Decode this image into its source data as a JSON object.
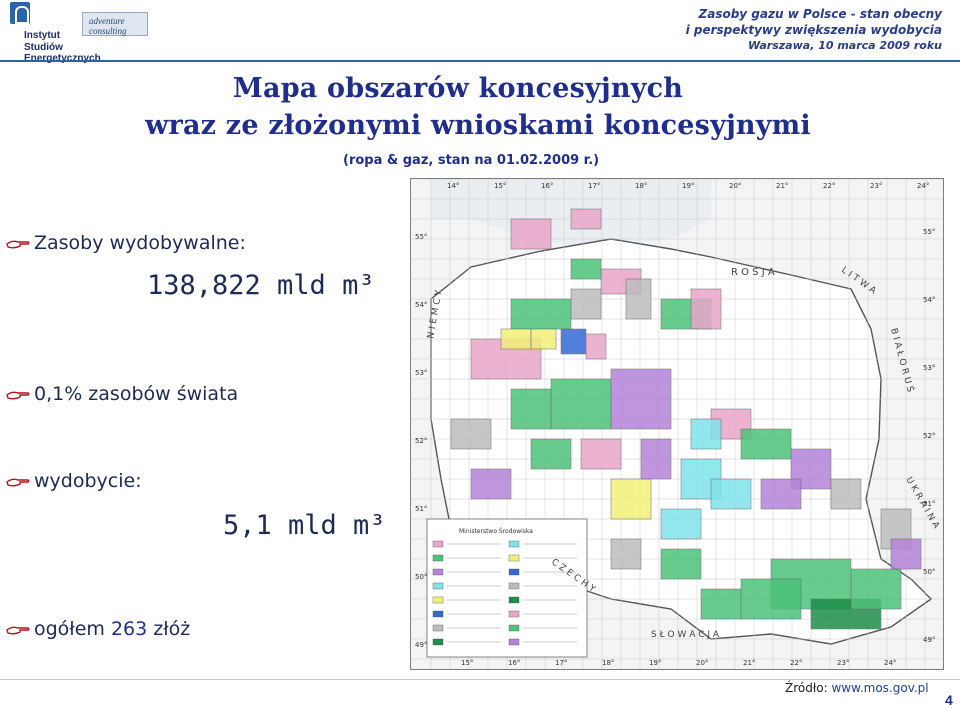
{
  "header": {
    "logo_line1": "Instytut",
    "logo_line2": "Studiów Energetycznych",
    "partner_logo": "adventure consulting",
    "conf_line1": "Zasoby gazu w Polsce - stan obecny",
    "conf_line2": "i perspektywy zwiększenia wydobycia",
    "conf_line3": "Warszawa, 10 marca 2009 roku"
  },
  "title": {
    "line1": "Mapa obszarów koncesyjnych",
    "line2": "wraz  ze złożonymi wnioskami koncesyjnymi"
  },
  "subtitle": "(ropa & gaz,  stan na 01.02.2009 r.)",
  "bullets": {
    "reserves_label": "Zasoby wydobywalne:",
    "reserves_value": "138,822 mld m³",
    "world_share": "0,1% zasobów świata",
    "production_label": "wydobycie:",
    "production_value": "5,1 mld m³",
    "total_prefix": "ogółem",
    "total_number": "263",
    "total_suffix": "złóż"
  },
  "map": {
    "top_degrees": [
      "14°",
      "15°",
      "16°",
      "17°",
      "18°",
      "19°",
      "20°",
      "21°",
      "22°",
      "23°",
      "24°"
    ],
    "bottom_degrees": [
      "15°",
      "16°",
      "17°",
      "18°",
      "19°",
      "20°",
      "21°",
      "22°",
      "23°",
      "24°"
    ],
    "left_degrees": [
      "55°",
      "54°",
      "53°",
      "52°",
      "51°",
      "50°",
      "49°"
    ],
    "right_degrees": [
      "55°",
      "54°",
      "53°",
      "52°",
      "51°",
      "50°",
      "49°"
    ],
    "country_labels": {
      "russia": "R O S J A",
      "lithuania": "L I T W A",
      "belarus": "B I A Ł O R U Ś",
      "ukraine": "U K R A I N A",
      "slovakia": "S Ł O W A C J A",
      "czech": "C Z E C H Y",
      "germany": "N I E M C Y"
    },
    "legend_title": "Ministerstwo Środowiska",
    "colors": {
      "pink": "#e9a6c9",
      "green": "#4cc27a",
      "purple": "#b484d8",
      "cyan": "#7fe3ea",
      "yellow": "#f3f07a",
      "blue": "#3468d6",
      "gray": "#bdbdbd",
      "darkgreen": "#1f8c4a"
    }
  },
  "footer": {
    "source_label": "Źródło:",
    "source_link": "www.mos.gov.pl",
    "page_number": "4"
  }
}
